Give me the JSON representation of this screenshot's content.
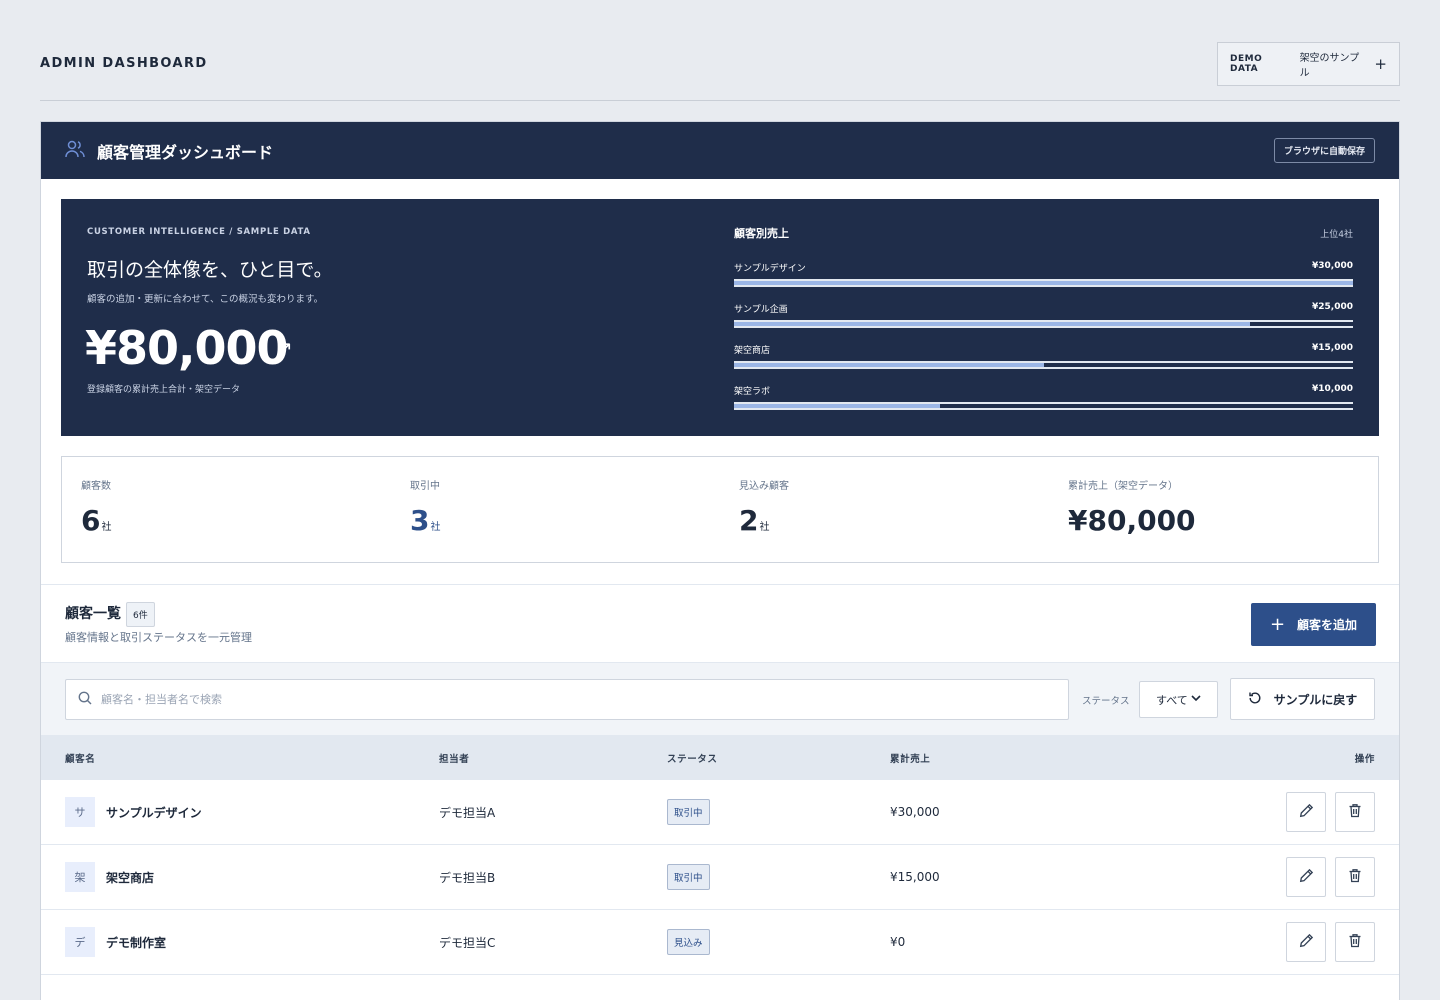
{
  "app": {
    "title": "ADMIN DASHBOARD",
    "demo_label": "DEMO DATA",
    "demo_value": "架空のサンプル",
    "demo_plus": "+"
  },
  "card": {
    "title": "顧客管理ダッシュボード",
    "autosave": "ブラウザに自動保存"
  },
  "hero": {
    "eyebrow": "CUSTOMER INTELLIGENCE / SAMPLE DATA",
    "headline": "取引の全体像を、ひと目で。",
    "sub": "顧客の追加・更新に合わせて、この概況も変わります。",
    "total": "¥80,000",
    "arrow": "↗",
    "note": "登録顧客の累計売上合計・架空データ"
  },
  "revenue": {
    "title": "顧客別売上",
    "note": "上位4社",
    "items": [
      {
        "name": "サンプルデザイン",
        "value": "¥30,000",
        "ratio": 1.0
      },
      {
        "name": "サンプル企画",
        "value": "¥25,000",
        "ratio": 0.833
      },
      {
        "name": "架空商店",
        "value": "¥15,000",
        "ratio": 0.5
      },
      {
        "name": "架空ラボ",
        "value": "¥10,000",
        "ratio": 0.333
      }
    ]
  },
  "stats": [
    {
      "label": "顧客数",
      "value": "6",
      "unit": "社"
    },
    {
      "label": "取引中",
      "value": "3",
      "unit": "社"
    },
    {
      "label": "見込み顧客",
      "value": "2",
      "unit": "社"
    },
    {
      "label": "累計売上（架空データ）",
      "value": "¥80,000",
      "unit": ""
    }
  ],
  "list": {
    "title": "顧客一覧",
    "count": "6件",
    "sub": "顧客情報と取引ステータスを一元管理",
    "add_label": "顧客を追加",
    "add_plus": "+"
  },
  "filter": {
    "search_placeholder": "顧客名・担当者名で検索",
    "status_label": "ステータス",
    "status_value": "すべて",
    "reset_label": "サンプルに戻す"
  },
  "table": {
    "headers": {
      "name": "顧客名",
      "owner": "担当者",
      "status": "ステータス",
      "sales": "累計売上",
      "actions": "操作"
    },
    "rows": [
      {
        "initial": "サ",
        "name": "サンプルデザイン",
        "owner": "デモ担当A",
        "status": "取引中",
        "sales": "¥30,000"
      },
      {
        "initial": "架",
        "name": "架空商店",
        "owner": "デモ担当B",
        "status": "取引中",
        "sales": "¥15,000"
      },
      {
        "initial": "デ",
        "name": "デモ制作室",
        "owner": "デモ担当C",
        "status": "見込み",
        "sales": "¥0"
      }
    ]
  }
}
